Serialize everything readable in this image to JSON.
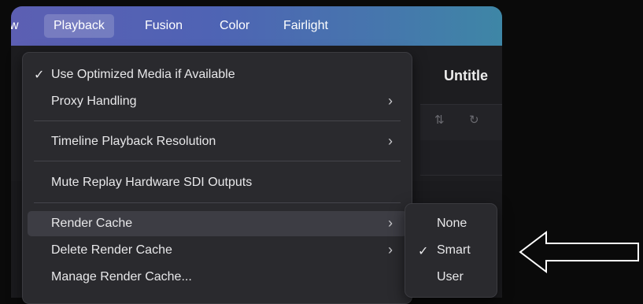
{
  "menubar": {
    "items": [
      {
        "label": "w"
      },
      {
        "label": "Playback",
        "active": true
      },
      {
        "label": "Fusion"
      },
      {
        "label": "Color"
      },
      {
        "label": "Fairlight"
      }
    ]
  },
  "background": {
    "title": "Untitle"
  },
  "menu": {
    "items": [
      {
        "label": "Use Optimized Media if Available",
        "checked": true
      },
      {
        "label": "Proxy Handling",
        "submenu": true
      },
      {
        "label": "Timeline Playback Resolution",
        "submenu": true
      },
      {
        "label": "Mute Replay Hardware SDI Outputs"
      },
      {
        "label": "Render Cache",
        "submenu": true,
        "highlighted": true
      },
      {
        "label": "Delete Render Cache",
        "submenu": true
      },
      {
        "label": "Manage Render Cache..."
      }
    ],
    "check_glyph": "✓",
    "chevron_glyph": "›"
  },
  "submenu": {
    "items": [
      {
        "label": "None"
      },
      {
        "label": "Smart",
        "checked": true
      },
      {
        "label": "User"
      }
    ]
  },
  "icons": {
    "sort": "sort-icon",
    "refresh": "refresh-icon",
    "annotation_arrow": "left-arrow-icon"
  },
  "colors": {
    "menubar_gradient_start": "#5c5fb3",
    "menubar_gradient_end": "#3e86a6",
    "menu_bg": "#2a2a2e",
    "highlight": "#3d3d44"
  }
}
